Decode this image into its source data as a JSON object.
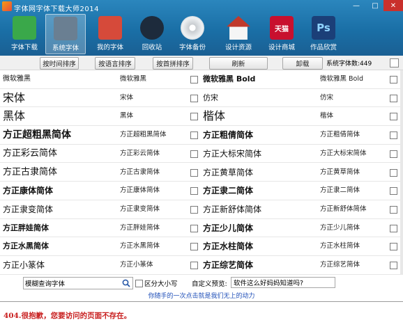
{
  "app": {
    "title": "字体网字体下载大师2014",
    "window_buttons": {
      "minimize": "—",
      "maximize": "□",
      "close": "✕"
    }
  },
  "toolbar": [
    {
      "label": "字体下载",
      "icon": "download-icon",
      "color": "#3aa84a",
      "active": false
    },
    {
      "label": "系统字体",
      "icon": "monitor-icon",
      "color": "#6a7f92",
      "active": true
    },
    {
      "label": "我的字体",
      "icon": "books-icon",
      "color": "#d64a3a",
      "active": false
    },
    {
      "label": "回收站",
      "icon": "recycle-icon",
      "color": "#1d2b3c",
      "active": false
    },
    {
      "label": "字体备份",
      "icon": "disc-icon",
      "color": "#c8ccd0",
      "active": false
    },
    {
      "label": "设计资源",
      "icon": "house-icon",
      "color": "#e3e3e3",
      "active": false
    },
    {
      "label": "设计商城",
      "icon": "tmall-icon",
      "color": "#c8102e",
      "active": false
    },
    {
      "label": "作品欣赏",
      "icon": "photoshop-icon",
      "color": "#1b3f78",
      "active": false
    }
  ],
  "tmall_icon_text": "天猫",
  "ps_icon_text": "Ps",
  "sortbar": {
    "sort_by_time": "按时间排序",
    "sort_by_type": "按语言排序",
    "sort_by_pinyin": "按首拼排序",
    "refresh": "刷新",
    "uninstall": "卸载",
    "font_count": "系统字体数:449"
  },
  "fonts": [
    {
      "preview": "微软雅黑",
      "name": "微软雅黑"
    },
    {
      "preview": "微软雅黑 Bold",
      "name": "微软雅黑 Bold"
    },
    {
      "preview": "宋体",
      "name": "宋体"
    },
    {
      "preview": "仿宋",
      "name": "仿宋"
    },
    {
      "preview": "黑体",
      "name": "黑体"
    },
    {
      "preview": "楷体",
      "name": "楷体"
    },
    {
      "preview": "方正超粗黑简体",
      "name": "方正超粗黑简体"
    },
    {
      "preview": "方正粗倩简体",
      "name": "方正粗倩简体"
    },
    {
      "preview": "方正彩云简体",
      "name": "方正彩云简体"
    },
    {
      "preview": "方正大标宋简体",
      "name": "方正大标宋简体"
    },
    {
      "preview": "方正古隶简体",
      "name": "方正古隶简体"
    },
    {
      "preview": "方正黄草简体",
      "name": "方正黄草简体"
    },
    {
      "preview": "方正康体简体",
      "name": "方正康体简体"
    },
    {
      "preview": "方正隶二简体",
      "name": "方正隶二简体"
    },
    {
      "preview": "方正隶变简体",
      "name": "方正隶变简体"
    },
    {
      "preview": "方正新舒体简体",
      "name": "方正新舒体简体"
    },
    {
      "preview": "方正胖娃简体",
      "name": "方正胖娃简体"
    },
    {
      "preview": "方正少儿简体",
      "name": "方正少儿简体"
    },
    {
      "preview": "方正水黑简体",
      "name": "方正水黑简体"
    },
    {
      "preview": "方正水柱简体",
      "name": "方正水柱简体"
    },
    {
      "preview": "方正小篆体",
      "name": "方正小篆体"
    },
    {
      "preview": "方正综艺简体",
      "name": "方正综艺简体"
    }
  ],
  "bottom": {
    "search_value": "模糊查询字体",
    "case_label": "区分大小写",
    "custom_preview_label": "自定义预览:",
    "custom_preview_value": "软件这么好妈妈知道吗?",
    "slogan": "你随手的一次点击就是我们无上的动力"
  },
  "webpanel": {
    "error_text": "404.很抱歉，您要访问的页面不存在。"
  }
}
